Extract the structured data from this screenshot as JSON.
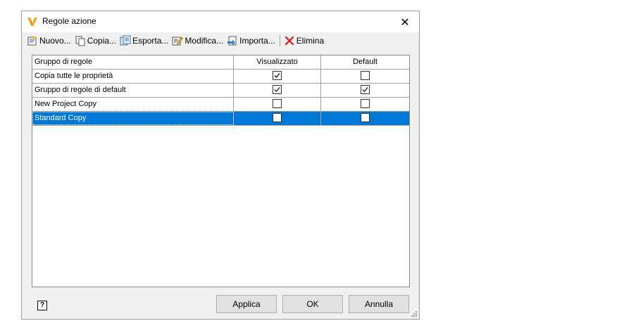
{
  "window": {
    "title": "Regole azione",
    "close_glyph": "✕"
  },
  "toolbar": {
    "new_label": "Nuovo...",
    "copy_label": "Copia...",
    "export_label": "Esporta...",
    "edit_label": "Modifica...",
    "import_label": "Importa...",
    "delete_label": "Elimina"
  },
  "table": {
    "columns": [
      "Gruppo di regole",
      "Visualizzato",
      "Default"
    ],
    "rows": [
      {
        "name": "Copia tutte le proprietà",
        "displayed": true,
        "default": false
      },
      {
        "name": "Gruppo di regole di default",
        "displayed": true,
        "default": true
      },
      {
        "name": "New Project Copy",
        "displayed": false,
        "default": false
      },
      {
        "name": "Standard Copy",
        "displayed": false,
        "default": false,
        "selected": true
      }
    ]
  },
  "footer": {
    "help_label": "?",
    "apply_label": "Applica",
    "ok_label": "OK",
    "cancel_label": "Annulla"
  },
  "colors": {
    "selection": "#0078d7",
    "app_icon": "#f5a623"
  }
}
